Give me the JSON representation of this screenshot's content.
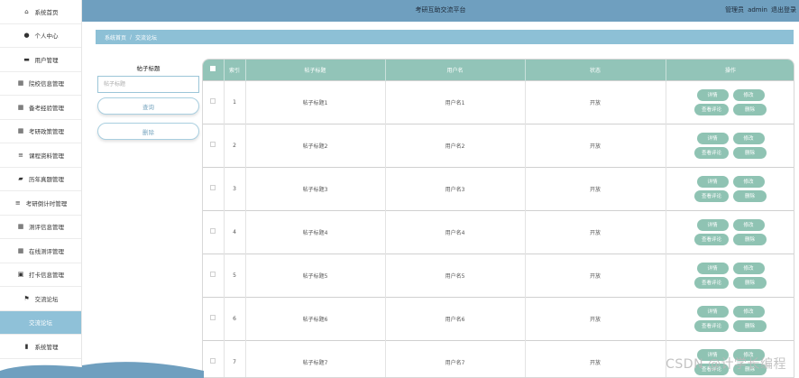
{
  "header": {
    "title": "考研互助交流平台",
    "user_role": "管理员",
    "user_name": "admin",
    "logout": "退出登录"
  },
  "sidebar": {
    "items": [
      {
        "label": "系统首页",
        "icon": "home-icon",
        "glyph": "⌂"
      },
      {
        "label": "个人中心",
        "icon": "user-icon",
        "glyph": "●"
      },
      {
        "label": "用户管理",
        "icon": "users-icon",
        "glyph": "▬"
      },
      {
        "label": "院校信息管理",
        "icon": "grid-icon",
        "glyph": "▦"
      },
      {
        "label": "备考经验管理",
        "icon": "grid-icon",
        "glyph": "▦"
      },
      {
        "label": "考研政策管理",
        "icon": "grid-icon",
        "glyph": "▦"
      },
      {
        "label": "课程资料管理",
        "icon": "list-icon",
        "glyph": "≡"
      },
      {
        "label": "历年真题管理",
        "icon": "book-icon",
        "glyph": "▰"
      },
      {
        "label": "考研倒计时管理",
        "icon": "list-icon",
        "glyph": "≡"
      },
      {
        "label": "测评信息管理",
        "icon": "grid-icon",
        "glyph": "▦"
      },
      {
        "label": "在线测评管理",
        "icon": "grid-icon",
        "glyph": "▦"
      },
      {
        "label": "打卡信息管理",
        "icon": "calendar-icon",
        "glyph": "▣"
      },
      {
        "label": "交流论坛",
        "icon": "flag-icon",
        "glyph": "⚑"
      },
      {
        "label": "交流论坛",
        "icon": "",
        "glyph": ""
      },
      {
        "label": "系统管理",
        "icon": "settings-icon",
        "glyph": "▮"
      }
    ]
  },
  "breadcrumb": {
    "home": "系统首页",
    "separator": "/",
    "current": "交流论坛"
  },
  "search": {
    "label": "帖子标题",
    "placeholder": "帖子标题",
    "query_button": "查询",
    "delete_button": "删除"
  },
  "table": {
    "columns": [
      "",
      "索引",
      "帖子标题",
      "用户名",
      "状态",
      "操作"
    ],
    "rows": [
      {
        "index": "1",
        "title": "帖子标题1",
        "user": "用户名1",
        "status": "开放"
      },
      {
        "index": "2",
        "title": "帖子标题2",
        "user": "用户名2",
        "status": "开放"
      },
      {
        "index": "3",
        "title": "帖子标题3",
        "user": "用户名3",
        "status": "开放"
      },
      {
        "index": "4",
        "title": "帖子标题4",
        "user": "用户名4",
        "status": "开放"
      },
      {
        "index": "5",
        "title": "帖子标题5",
        "user": "用户名5",
        "status": "开放"
      },
      {
        "index": "6",
        "title": "帖子标题6",
        "user": "用户名6",
        "status": "开放"
      },
      {
        "index": "7",
        "title": "帖子标题7",
        "user": "用户名7",
        "status": "开放"
      }
    ],
    "actions": {
      "detail": "详情",
      "edit": "修改",
      "comments": "查看评论",
      "delete": "删除"
    }
  },
  "watermark": "CSDN @计学长编程",
  "colors": {
    "header": "#6f9fbf",
    "breadcrumb": "#8dc0d6",
    "table_head": "#92c4b8",
    "action_button": "#8fc3b3",
    "sidebar_active": "#8fc1d8"
  }
}
